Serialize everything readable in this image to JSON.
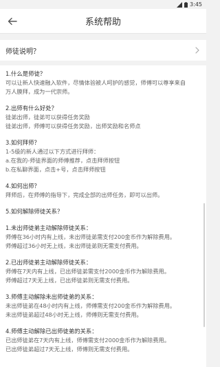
{
  "status": {
    "time": "3:45"
  },
  "header": {
    "title": "系统帮助"
  },
  "question": {
    "label": "师徒说明？"
  },
  "sections": [
    {
      "heading": "1.什么是师徒？",
      "lines": [
        "可以让新人快速融入软件，尽情体验被人呵护的感觉，师傅可以尊享来自",
        "万人膜拜，成为一代宗师。"
      ]
    },
    {
      "heading": "2.出师有什么好处？",
      "lines": [
        "徒弟出师，徒弟可以获得任务奖励",
        "徒弟出师，师傅可以获得任务奖励，出师奖励和名师点"
      ]
    },
    {
      "heading": "3.如何拜师？",
      "lines": [
        "1-5级的新人通过以下方式进行拜师：",
        "a.在我的-师徒界面的师傅推荐，点击拜师按钮",
        "b.在私聊界面，点击+号，点击拜师按钮"
      ]
    },
    {
      "heading": "4.如何出师？",
      "lines": [
        "拜师后，在师傅的指导下，完成全部的出师任务，即可以出师。"
      ]
    },
    {
      "heading": "5.如何解除师徒关系？",
      "lines": []
    },
    {
      "heading": "1.未出师徒弟主动解除师徒关系：",
      "lines": [
        "师傅在36小时内有上线，未出师徒弟需支付200金币作为解除费用。",
        "师傅超过36小时无上线，未出师徒弟则无需支付费用。"
      ]
    },
    {
      "heading": "2.已出师徒弟主动解除师徒关系：",
      "lines": [
        "师傅在7天内有上线，已出师徒弟需支付2000金币作为解除费用。",
        "师傅超过7天无上线，已出师徒弟则无需支付费用。"
      ]
    },
    {
      "heading": "3.师傅主动解除未出师徒弟的关系：",
      "lines": [
        "未出师徒弟在48小时内有上线，师傅需支付200金币作为解除费用。",
        "未出师徒弟超过48小时无上线，师傅则无需支付费用。"
      ]
    },
    {
      "heading": "4.师傅主动解除已出师徒弟的关系：",
      "lines": [
        "已出师徒弟在7天内有上线，师傅需支付2000金币作为解除费用。",
        "已出师徒弟超过7天无上线，师傅则无需支付费用。"
      ]
    }
  ]
}
